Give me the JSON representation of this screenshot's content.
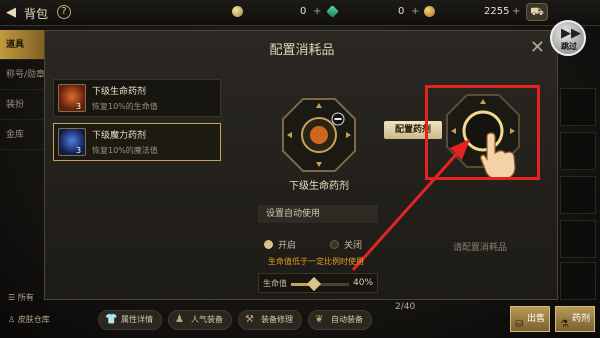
{
  "topbar": {
    "back_glyph": "◀",
    "title": "背包",
    "help_glyph": "?",
    "currency_moon_value": "0",
    "currency_gem_value": "0",
    "currency_gold_value": "2255",
    "plus_glyph": "+",
    "skip_label": "跳过",
    "skip_glyph": "▶▶"
  },
  "sidebar": {
    "tabs": [
      {
        "label": "道具"
      },
      {
        "label": "称号/勋章"
      },
      {
        "label": "装扮"
      },
      {
        "label": "金库"
      }
    ]
  },
  "modal": {
    "title": "配置消耗品",
    "close_glyph": "✕",
    "items": [
      {
        "name": "下级生命药剂",
        "desc": "恢复10%的生命值",
        "count": "3",
        "icon": "red-potion-icon"
      },
      {
        "name": "下级魔力药剂",
        "desc": "恢复10%的魔法值",
        "count": "3",
        "icon": "blue-potion-icon"
      }
    ],
    "slot1_name": "下级生命药剂",
    "assign_button": "配置药剂",
    "empty_slot_hint": "请配置消耗品",
    "auto_use": {
      "header": "设置自动使用",
      "on_label": "开启",
      "off_label": "关闭",
      "selected": "on",
      "warning": "生命值低于一定比例时使用",
      "slider_label": "生命值",
      "slider_value": "40%",
      "slider_fraction": 0.4
    }
  },
  "page_count": "2/40",
  "bottom": {
    "left_items": [
      "所有",
      "皮肤仓库"
    ],
    "buttons": [
      {
        "label": "属性详情",
        "icon": "shirt-icon"
      },
      {
        "label": "人气装备",
        "icon": "person-icon"
      },
      {
        "label": "装备修理",
        "icon": "hammer-icon"
      },
      {
        "label": "自动装备",
        "icon": "wings-icon"
      }
    ],
    "sell_label": "出售",
    "potion_label": "药剂"
  },
  "colors": {
    "accent_gold": "#c7a35a",
    "highlight_red": "#e52320",
    "warning_orange": "#e0a020"
  }
}
